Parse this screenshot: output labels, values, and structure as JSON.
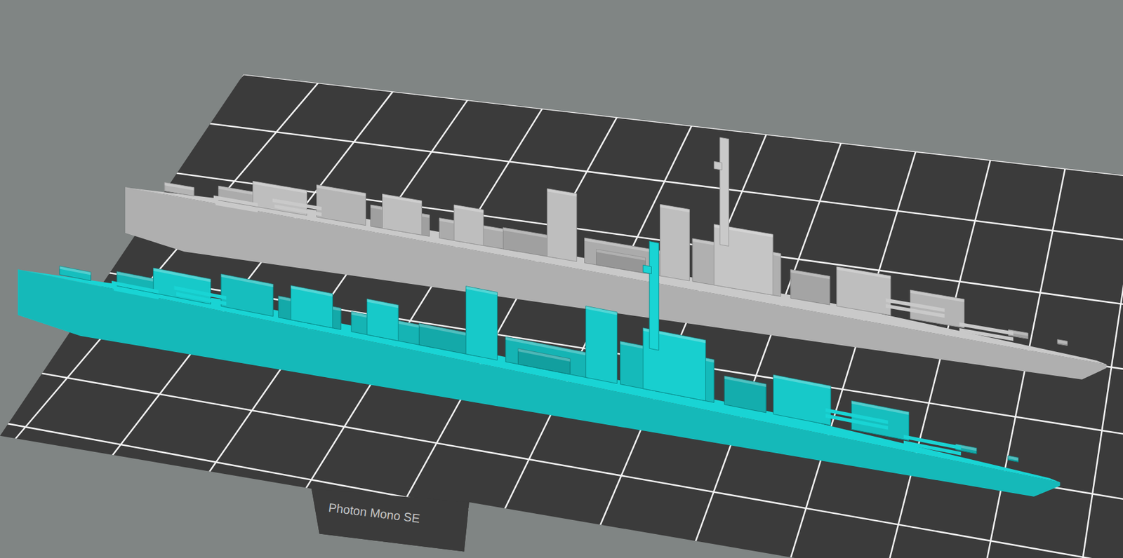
{
  "viewport": {
    "printer_label": "Photon Mono SE"
  },
  "models": [
    {
      "name": "ship-gray",
      "selected": false,
      "color": "#c9c9c9"
    },
    {
      "name": "ship-cyan",
      "selected": true,
      "color": "#19d4d4"
    }
  ]
}
